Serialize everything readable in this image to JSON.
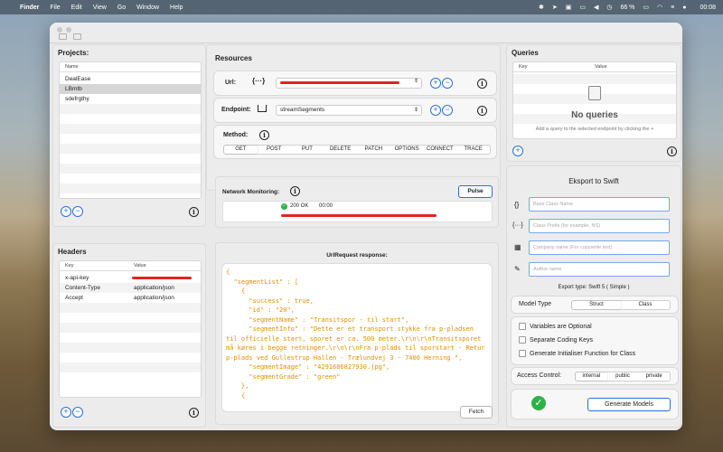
{
  "menubar": {
    "app": "Finder",
    "items": [
      "File",
      "Edit",
      "View",
      "Go",
      "Window",
      "Help"
    ],
    "battery": "66 %",
    "clock": "00:08"
  },
  "projects": {
    "title": "Projects:",
    "column": "Name",
    "items": [
      "DealEase",
      "LBmtb",
      "sdefrgthy"
    ]
  },
  "headers": {
    "title": "Headers",
    "col_key": "Key",
    "col_value": "Value",
    "rows": [
      {
        "key": "x-api-key",
        "value": ""
      },
      {
        "key": "Content-Type",
        "value": "application/json"
      },
      {
        "key": "Accept",
        "value": "application/json"
      }
    ]
  },
  "resources": {
    "title": "Resources",
    "url_label": "Url:",
    "endpoint_label": "Endpoint:",
    "endpoint_value": "streamSegments",
    "method_label": "Method:",
    "methods": [
      "GET",
      "POST",
      "PUT",
      "DELETE",
      "PATCH",
      "OPTIONS",
      "CONNECT",
      "TRACE"
    ],
    "selected_method": "GET"
  },
  "monitoring": {
    "label": "Network Monitoring:",
    "pulse": "Pulse",
    "status": "200 OK",
    "time": "00:00"
  },
  "response": {
    "title": "UrlRequest response:",
    "body": "{\n  \"segmentList\" : [\n    {\n      \"success\" : true,\n      \"id\" : \"20\",\n      \"segmentName\" : \"Transitspor - til start\",\n      \"segmentInfo\" : \"Dette er et transport stykke fra p-pladsen til officielle start, sporet er ca. 500 meter.\\r\\n\\r\\nTransitsporet må køres i begge retninger.\\r\\n\\r\\nFra p-plads til sporstart - Retur p-plads ved Gullestrup Hallen - Trælundvej 3 - 7400 Herning \",\n      \"segmentImage\" : \"4291686827930.jpg\",\n      \"segmentGrade\" : \"green\"\n    },\n    {",
    "fetch": "Fetch"
  },
  "queries": {
    "title": "Queries",
    "col_key": "Key",
    "col_value": "Value",
    "empty_title": "No queries",
    "empty_hint": "Add a query to the selected endpoint by clicking the +"
  },
  "export": {
    "title": "Eksport to Swift",
    "fields": [
      {
        "icon": "{}",
        "placeholder": "Base Class Name"
      },
      {
        "icon": "{···}",
        "placeholder": "Class Prefix (for example, NS)"
      },
      {
        "icon": "▦",
        "placeholder": "Company name (For copywrite text)"
      },
      {
        "icon": "✎",
        "placeholder": "Author name"
      }
    ],
    "export_type": "Export type: Swift 5 ( Simple )",
    "model_type_label": "Model Type",
    "model_types": [
      "Struct",
      "Class"
    ],
    "options": [
      "Variables are Optional",
      "Separate Coding Keys",
      "Generate Initialiser Function for Class"
    ],
    "access_label": "Access Control:",
    "access": [
      "internal",
      "public",
      "private"
    ],
    "generate": "Generate Models"
  },
  "colors": {
    "accent": "#2a6fd6",
    "code": "#e28f00",
    "redact": "#e0261f",
    "ok": "#2fb14a"
  }
}
